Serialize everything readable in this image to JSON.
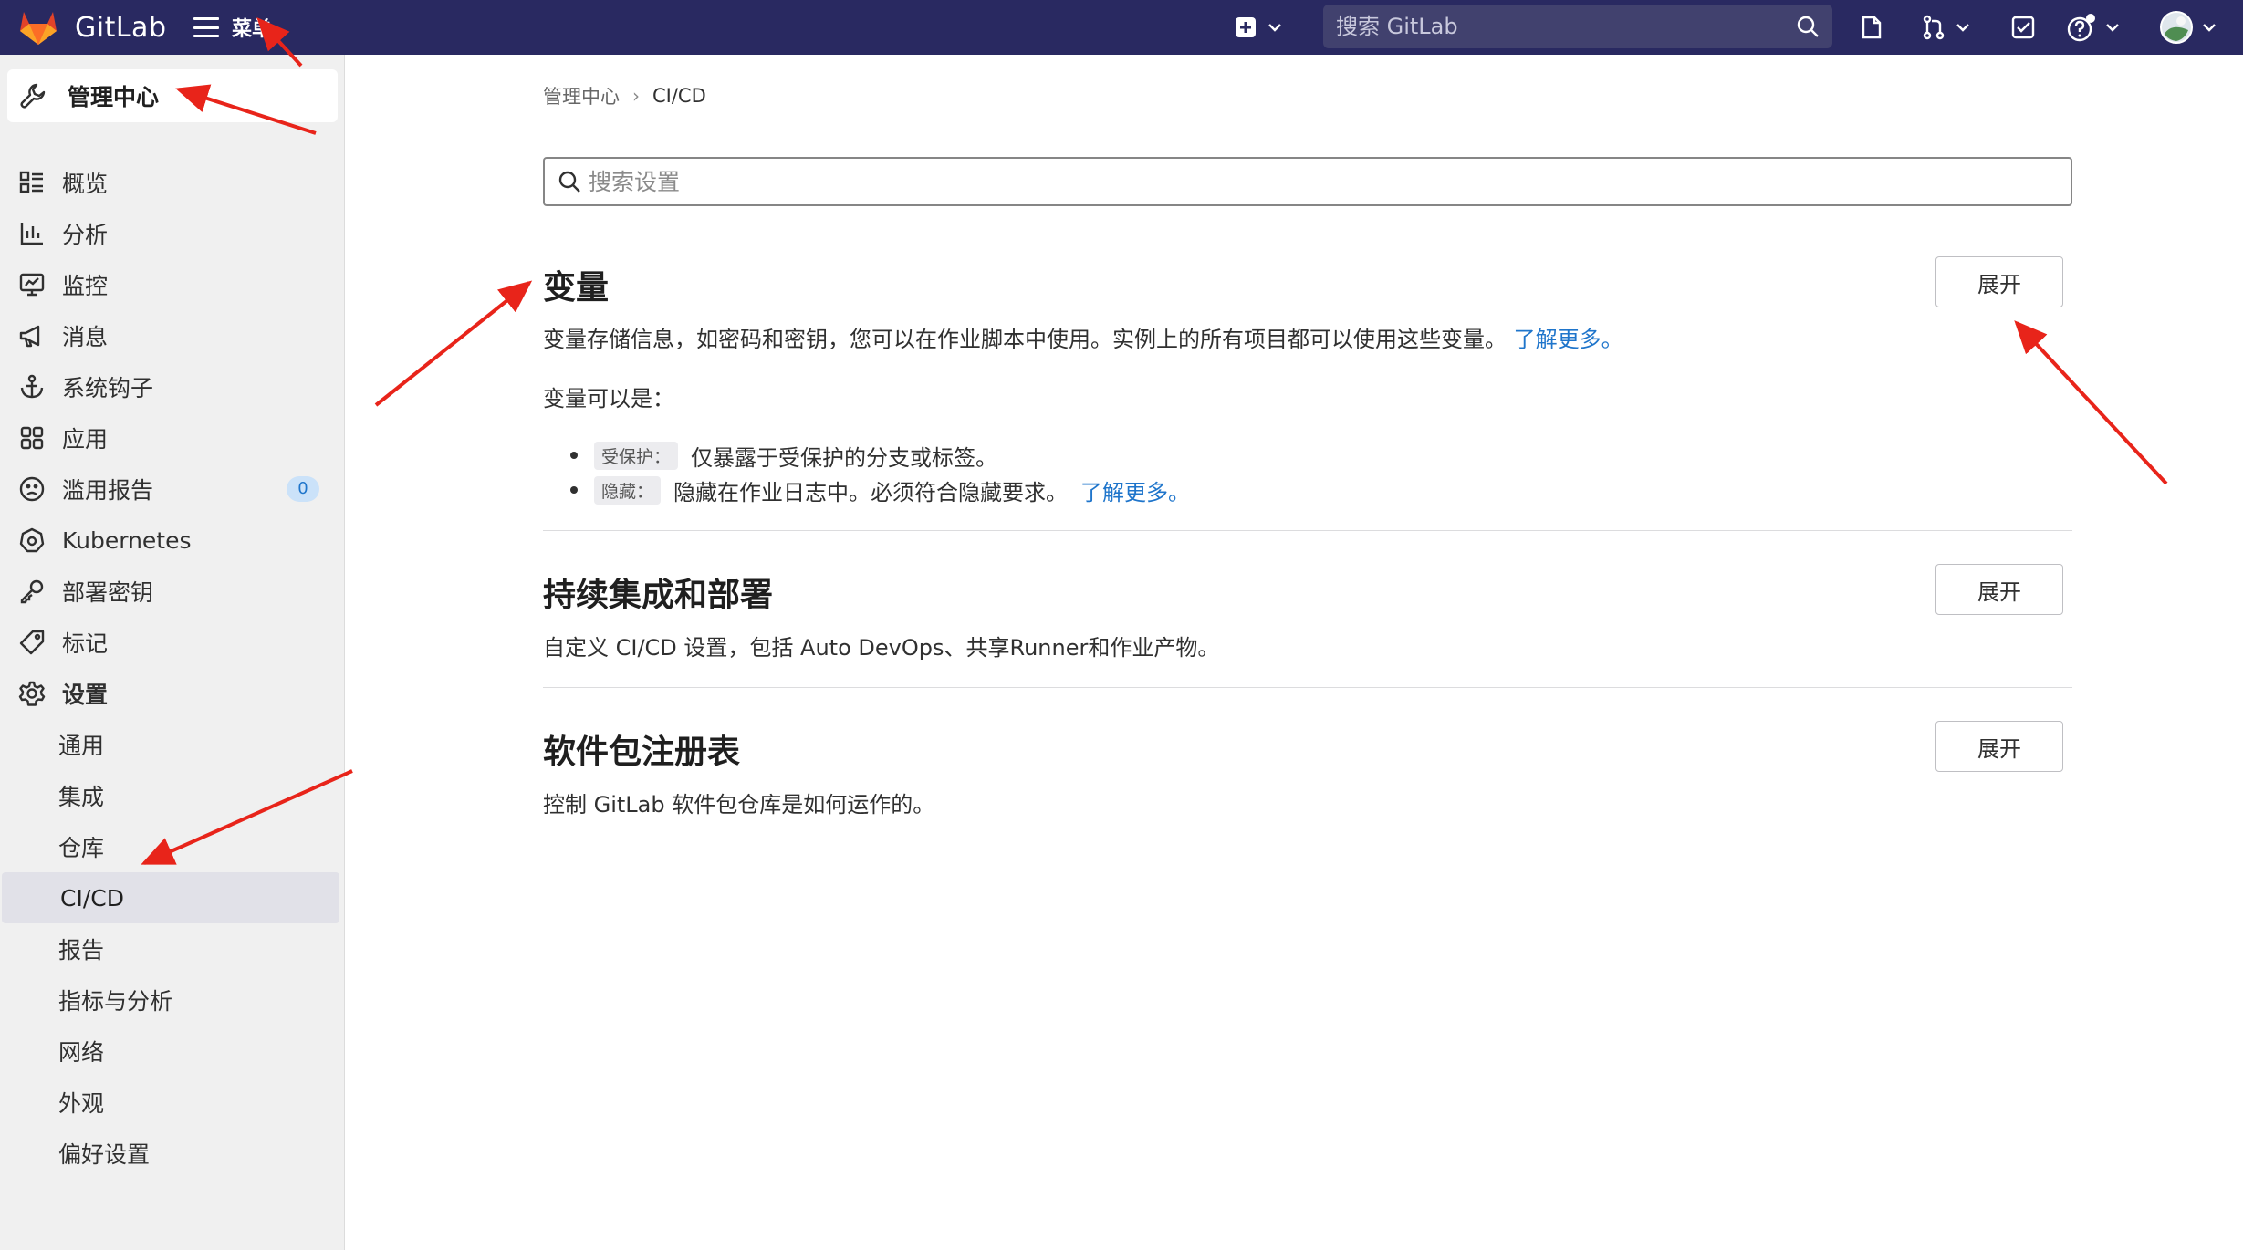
{
  "navbar": {
    "brand": "GitLab",
    "menu_label": "菜单",
    "search_placeholder": "搜索 GitLab",
    "bg_color": "#292961"
  },
  "sidebar": {
    "header": "管理中心",
    "items": [
      {
        "label": "概览",
        "icon": "grid-list-icon"
      },
      {
        "label": "分析",
        "icon": "chart-icon"
      },
      {
        "label": "监控",
        "icon": "monitor-icon"
      },
      {
        "label": "消息",
        "icon": "megaphone-icon"
      },
      {
        "label": "系统钩子",
        "icon": "anchor-icon"
      },
      {
        "label": "应用",
        "icon": "apps-icon"
      },
      {
        "label": "滥用报告",
        "icon": "abuse-icon",
        "badge": "0"
      },
      {
        "label": "Kubernetes",
        "icon": "kubernetes-icon"
      },
      {
        "label": "部署密钥",
        "icon": "key-icon"
      },
      {
        "label": "标记",
        "icon": "tag-icon"
      },
      {
        "label": "设置",
        "icon": "gear-icon"
      }
    ],
    "settings_sub": [
      "通用",
      "集成",
      "仓库",
      "CI/CD",
      "报告",
      "指标与分析",
      "网络",
      "外观",
      "偏好设置"
    ],
    "active_sub": "CI/CD"
  },
  "main": {
    "breadcrumb": {
      "parent": "管理中心",
      "current": "CI/CD"
    },
    "settings_search_placeholder": "搜索设置",
    "sections": [
      {
        "title": "变量",
        "desc": "变量存储信息，如密码和密钥，您可以在作业脚本中使用。实例上的所有项目都可以使用这些变量。",
        "link": "了解更多。",
        "sub_heading": "变量可以是：",
        "bullets": [
          {
            "code": "受保护：",
            "text": "仅暴露于受保护的分支或标签。",
            "link": ""
          },
          {
            "code": "隐藏：",
            "text": "隐藏在作业日志中。必须符合隐藏要求。",
            "link": "了解更多。"
          }
        ],
        "button": "展开"
      },
      {
        "title": "持续集成和部署",
        "desc": "自定义 CI/CD 设置，包括 Auto DevOps、共享Runner和作业产物。",
        "button": "展开"
      },
      {
        "title": "软件包注册表",
        "desc": "控制 GitLab 软件包仓库是如何运作的。",
        "button": "展开"
      }
    ]
  },
  "annotation_color": "#e8241a"
}
